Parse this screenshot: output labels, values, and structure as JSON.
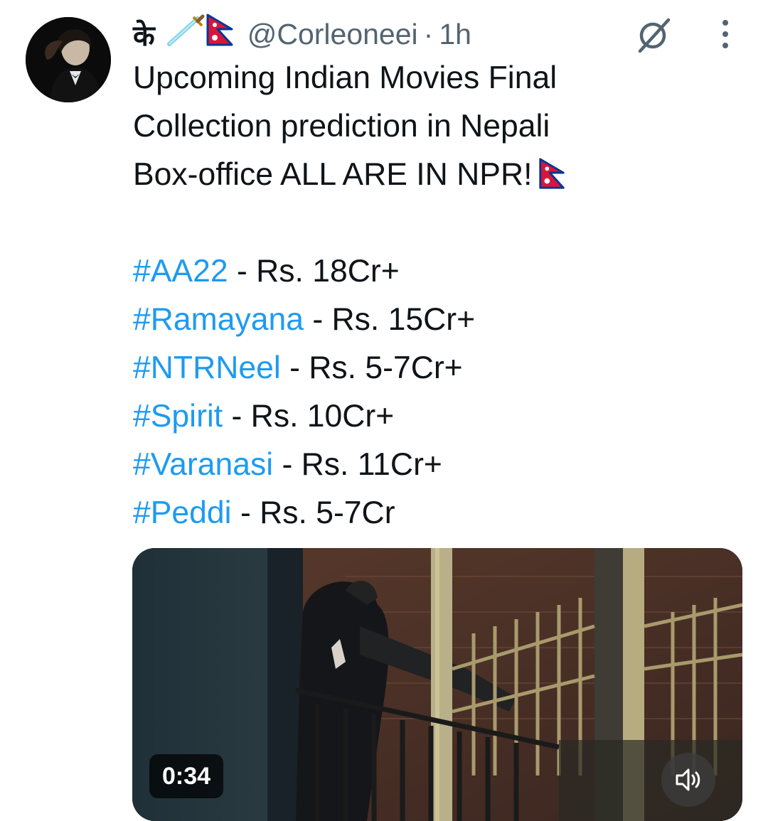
{
  "tweet": {
    "author": {
      "display_name": "के",
      "handle": "@Corleoneei",
      "separator": "·",
      "time": "1h"
    },
    "text_lines": [
      "Upcoming Indian Movies Final",
      "Collection prediction in Nepali",
      "Box-office ALL ARE IN NPR!"
    ],
    "predictions": [
      {
        "hashtag": "#AA22",
        "value": " - Rs. 18Cr+"
      },
      {
        "hashtag": "#Ramayana",
        "value": " - Rs. 15Cr+"
      },
      {
        "hashtag": "#NTRNeel",
        "value": " - Rs. 5-7Cr+"
      },
      {
        "hashtag": "#Spirit",
        "value": " - Rs. 10Cr+"
      },
      {
        "hashtag": "#Varanasi",
        "value": " - Rs. 11Cr+"
      },
      {
        "hashtag": "#Peddi",
        "value": " - Rs. 5-7Cr"
      }
    ],
    "video": {
      "duration": "0:34"
    }
  },
  "icons": {
    "dagger": "dagger-emoji",
    "flag": "nepal-flag-emoji",
    "grok": "grok-icon",
    "more": "more-vertical-icon",
    "volume": "volume-muted-icon"
  },
  "colors": {
    "hashtag": "#1d9bf0",
    "secondary_text": "#536471",
    "primary_text": "#0f1419"
  }
}
